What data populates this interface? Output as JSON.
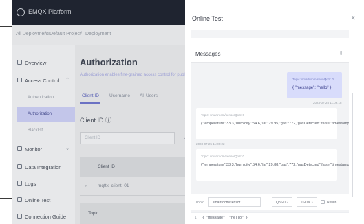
{
  "app": {
    "name": "EMQX Platform"
  },
  "breadcrumb": [
    "All Deployments",
    "Default Project",
    "Deployment"
  ],
  "sidebar": {
    "items": [
      {
        "label": "Overview",
        "icon": "overview-icon"
      },
      {
        "label": "Access Control",
        "icon": "lock-icon",
        "chevron": "⌃"
      },
      {
        "label": "Authentication",
        "sub": true
      },
      {
        "label": "Authorization",
        "sub": true,
        "active": true
      },
      {
        "label": "Blacklist",
        "sub": true
      },
      {
        "label": "Monitor",
        "icon": "monitor-icon",
        "chevron": "⌄"
      },
      {
        "label": "Data Integration",
        "icon": "integration-icon"
      },
      {
        "label": "Logs",
        "icon": "logs-icon"
      },
      {
        "label": "Online Test",
        "icon": "test-icon"
      },
      {
        "label": "Connection Guide",
        "icon": "guide-icon"
      }
    ]
  },
  "page": {
    "title": "Authorization",
    "subtitle": "Authorization enables fine-grained access control for publishing and subscribing...",
    "tabs": [
      "Client ID",
      "Username",
      "All Users"
    ],
    "client_title": "Client ID",
    "client_placeholder": "Client ID",
    "table": {
      "header": "Client ID",
      "row": "mqttx_client_01",
      "subheader": "Topic"
    }
  },
  "drawer": {
    "title": "Online Test",
    "messages_title": "Messages",
    "sent": {
      "topic": "Topic: smartroom/sensor",
      "qos": "QoS: 0",
      "payload": "{ \"message\": \"hello\" }",
      "time": "2023-07-25 11:09:18"
    },
    "received": [
      {
        "topic": "Topic: smartroom/sensor",
        "qos": "QoS: 0",
        "payload": "{\"temperature\":33.3,\"humidity\":54.6,\"lat\":29.95,\"gas\":772,\"gasDetected\":false,\"timestamp\":2170578}",
        "time": "2023-07-25 11:09:22"
      },
      {
        "topic": "Topic: smartroom/sensor",
        "qos": "QoS: 0",
        "payload": "{\"temperature\":33.3,\"humidity\":54.6,\"lat\":29.88,\"gas\":772,\"gasDetected\":false,\"timestamp\":2195630}"
      }
    ],
    "form": {
      "topic_label": "Topic",
      "topic_value": "smartroom/sensor",
      "qos_value": "QoS 0",
      "format_value": "JSON",
      "retain_label": "Retain"
    },
    "editor": {
      "line": "1",
      "code": "{ \"message\": \"hello\" }"
    }
  }
}
